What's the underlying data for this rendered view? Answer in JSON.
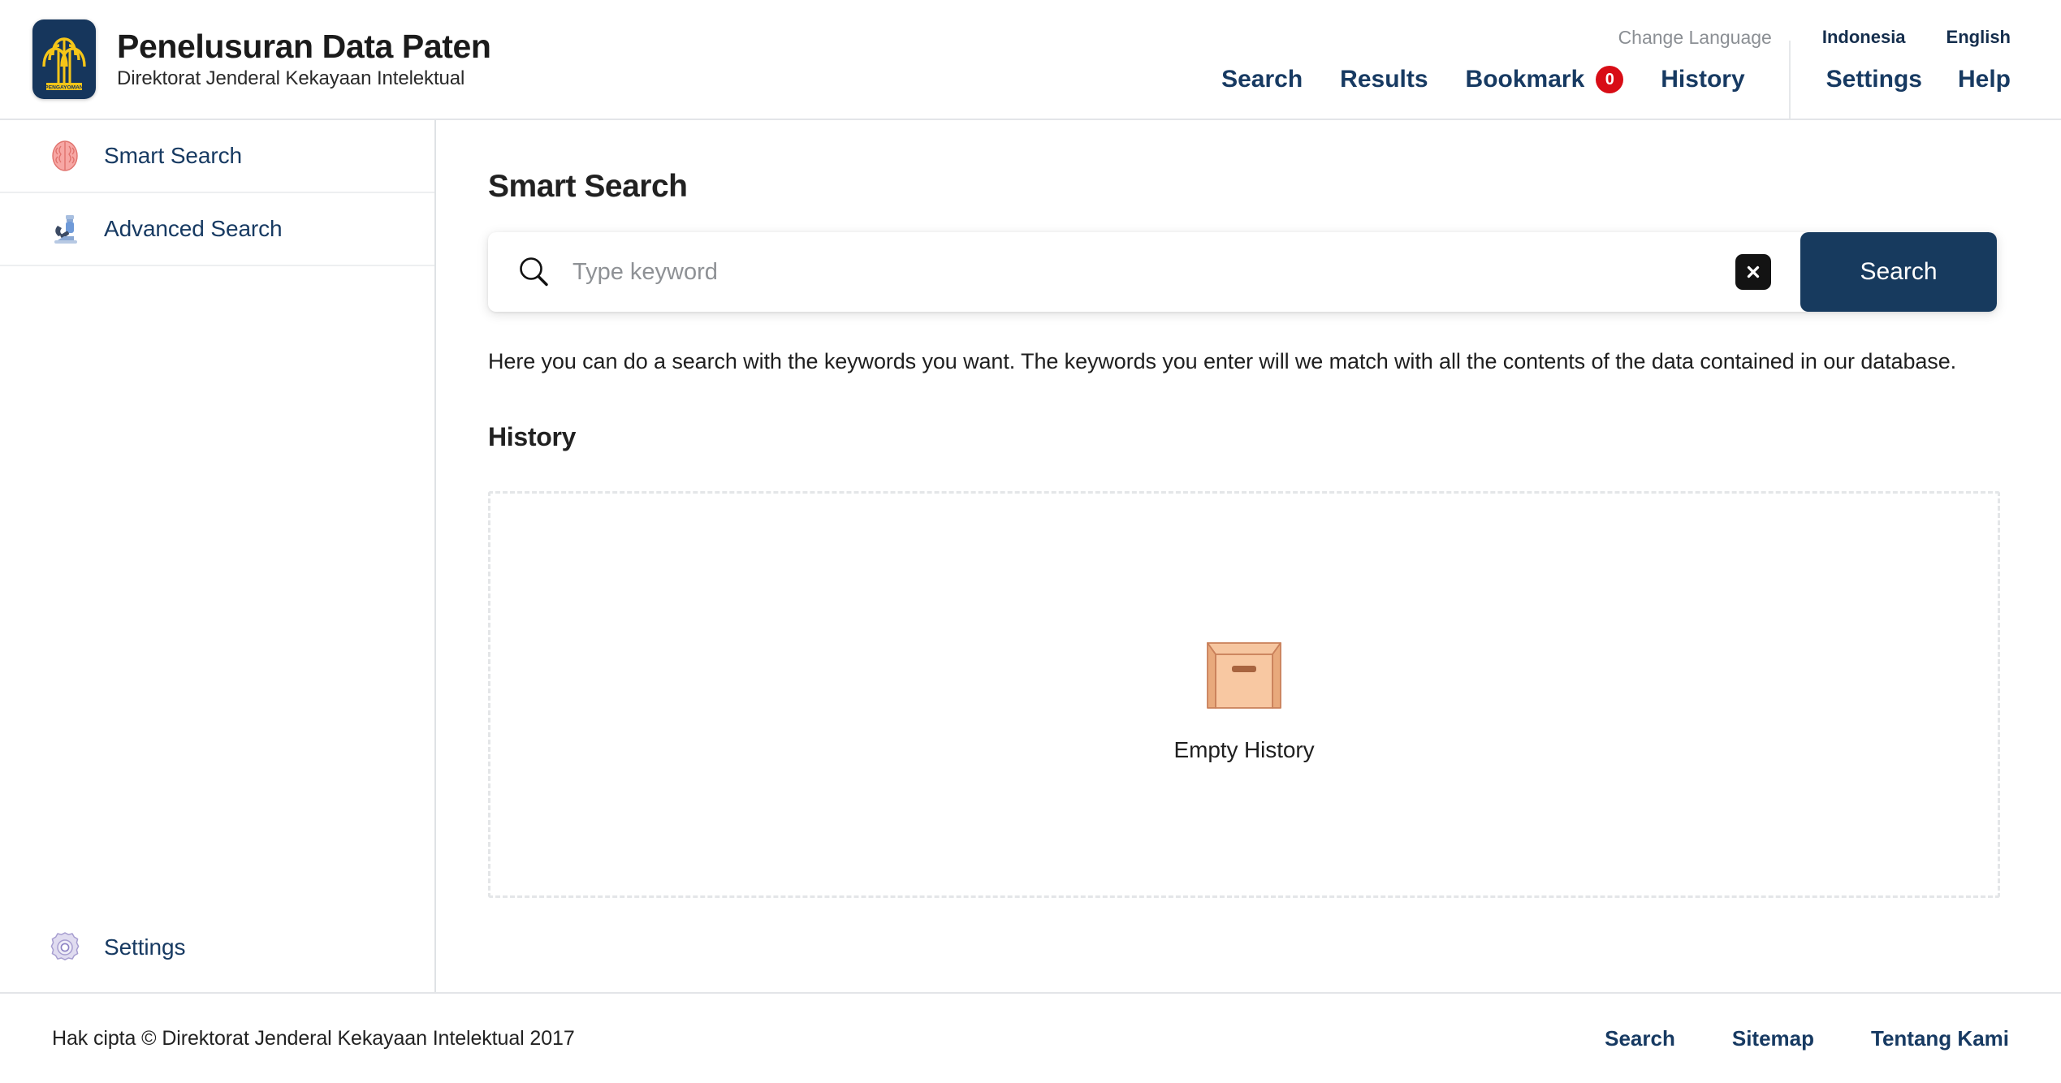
{
  "header": {
    "logo_icon": "pengayoman-tree-logo",
    "logo_caption": "PENGAYOMAN",
    "title": "Penelusuran Data Paten",
    "subtitle": "Direktorat Jenderal Kekayaan Intelektual",
    "change_language_label": "Change Language",
    "languages": [
      {
        "label": "Indonesia"
      },
      {
        "label": "English"
      }
    ],
    "nav_left": [
      {
        "label": "Search"
      },
      {
        "label": "Results"
      },
      {
        "label": "Bookmark",
        "badge": "0",
        "badge_color": "#d80d16"
      },
      {
        "label": "History"
      }
    ],
    "nav_right": [
      {
        "label": "Settings"
      },
      {
        "label": "Help"
      }
    ]
  },
  "sidebar": {
    "items": [
      {
        "label": "Smart Search",
        "icon": "brain-icon"
      },
      {
        "label": "Advanced Search",
        "icon": "microscope-icon"
      }
    ],
    "bottom_item": {
      "label": "Settings",
      "icon": "gear-icon"
    }
  },
  "main": {
    "page_title": "Smart Search",
    "search": {
      "placeholder": "Type keyword",
      "value": "",
      "search_icon": "magnifier-icon",
      "clear_icon": "close-x-icon",
      "button_label": "Search",
      "button_color": "#173a5e"
    },
    "description": "Here you can do a search with the keywords you want. The keywords you enter will we match with all the contents of the data contained in our database.",
    "history_section_title": "History",
    "empty_state": {
      "icon": "empty-box-icon",
      "label": "Empty History"
    }
  },
  "footer": {
    "copyright": "Hak cipta © Direktorat Jenderal Kekayaan Intelektual 2017",
    "links": [
      {
        "label": "Search"
      },
      {
        "label": "Sitemap"
      },
      {
        "label": "Tentang Kami"
      }
    ]
  }
}
